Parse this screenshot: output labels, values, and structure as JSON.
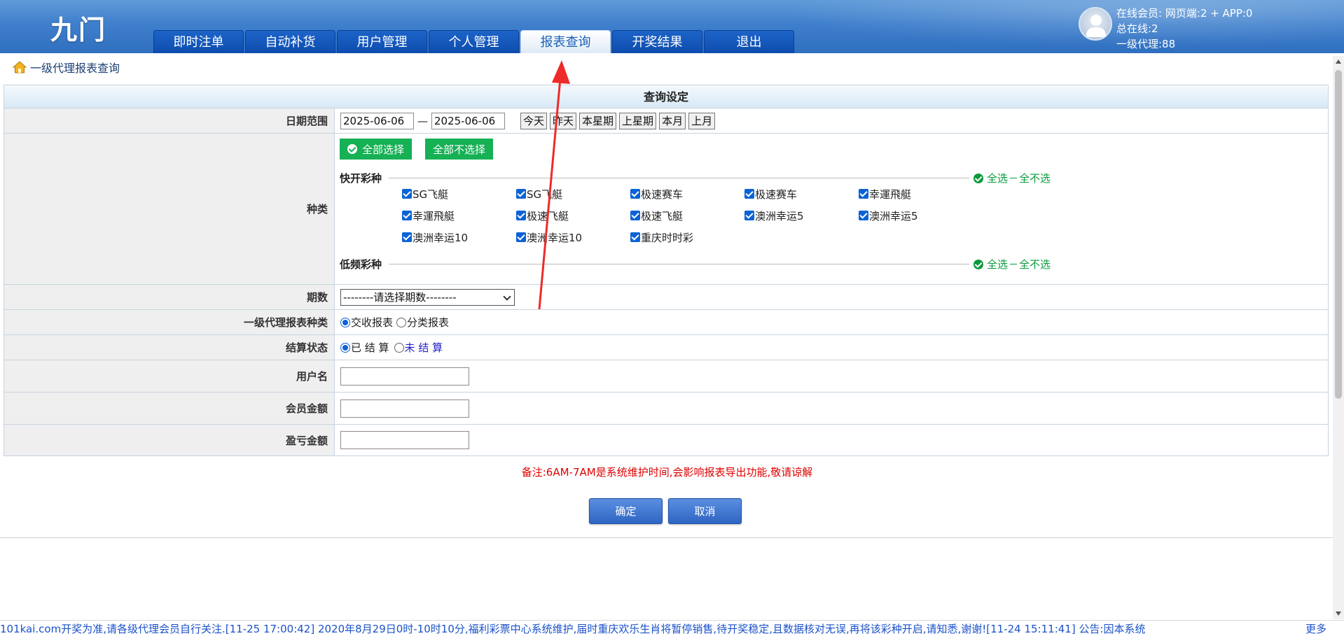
{
  "header": {
    "logo": "九门",
    "nav": [
      "即时注单",
      "自动补货",
      "用户管理",
      "个人管理",
      "报表查询",
      "开奖结果",
      "退出"
    ],
    "active_tab": "报表查询",
    "user_info": {
      "line1": "在线会员:   网页端:2 + APP:0",
      "line2": "总在线:2",
      "line3": "一级代理:88"
    }
  },
  "breadcrumb": "一级代理报表查询",
  "form": {
    "title": "查询设定",
    "date_range": {
      "label": "日期范围",
      "start": "2025-06-06",
      "separator": "—",
      "end": "2025-06-06",
      "quick": [
        "今天",
        "昨天",
        "本星期",
        "上星期",
        "本月",
        "上月"
      ]
    },
    "category": {
      "label": "种类",
      "select_all_btn": "全部选择",
      "select_none_btn": "全部不选择",
      "group_fast": {
        "name": "快开彩种",
        "all": "全选",
        "none": "全不选",
        "items": [
          "SG飞艇",
          "SG飞艇",
          "极速赛车",
          "极速赛车",
          "幸運飛艇",
          "幸運飛艇",
          "极速飞艇",
          "极速飞艇",
          "澳洲幸运5",
          "澳洲幸运5",
          "澳洲幸运10",
          "澳洲幸运10",
          "重庆时时彩"
        ]
      },
      "group_low": {
        "name": "低频彩种",
        "all": "全选",
        "none": "全不选"
      }
    },
    "period": {
      "label": "期数",
      "selected": "--------请选择期数--------"
    },
    "report_type": {
      "label": "一级代理报表种类",
      "options": [
        "交收报表",
        "分类报表"
      ]
    },
    "settle_status": {
      "label": "结算状态",
      "options": [
        "已 结 算",
        "未 结 算"
      ]
    },
    "username": {
      "label": "用户名",
      "value": ""
    },
    "member_amount": {
      "label": "会员金额",
      "value": ""
    },
    "profit_amount": {
      "label": "盈亏金额",
      "value": ""
    }
  },
  "note": "备注:6AM-7AM是系统维护时间,会影响报表导出功能,敬请谅解",
  "buttons": {
    "confirm": "确定",
    "cancel": "取消"
  },
  "ticker": {
    "text": "101kai.com开奖为准,请各级代理会员自行关注.[11-25 17:00:42] 2020年8月29日0时-10时10分,福利彩票中心系统维护,届时重庆欢乐生肖将暂停销售,待开奖稳定,且数据核对无误,再将该彩种开启,请知悉,谢谢![11-24 15:11:41] 公告:因本系统",
    "more": "更多"
  },
  "colors": {
    "header_blue": "#3f7fcc",
    "nav_blue": "#0e4cae",
    "green": "#16b055",
    "note_red": "#e00000",
    "arrow_red": "#ee2a2a"
  }
}
